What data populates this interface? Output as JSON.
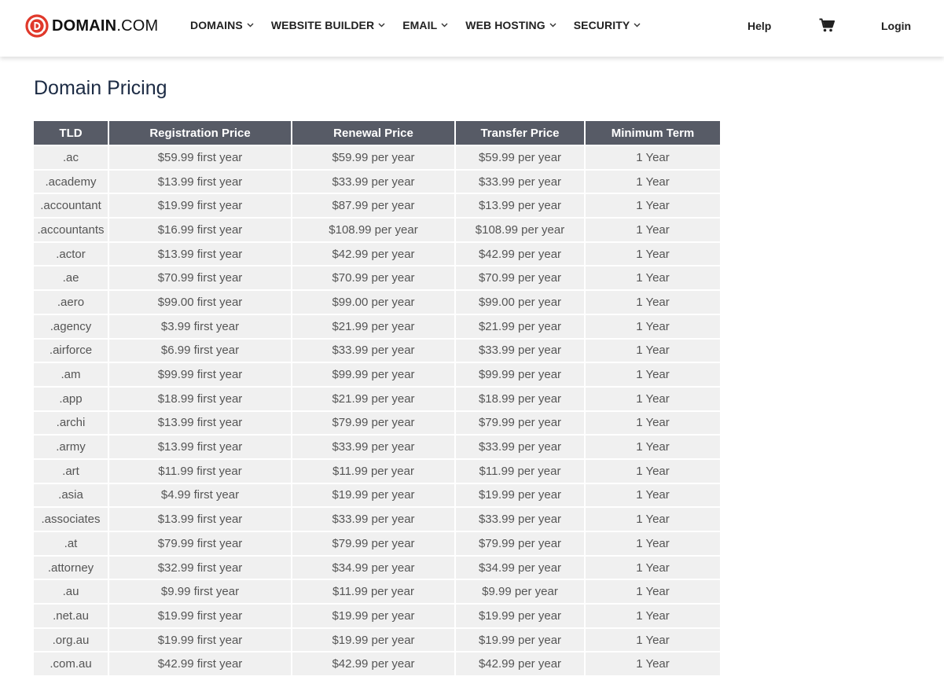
{
  "header": {
    "logo": {
      "brand": "DOMAIN",
      "suffix": ".COM"
    },
    "nav": [
      {
        "label": "DOMAINS",
        "icon": "chevron-down-icon"
      },
      {
        "label": "WEBSITE BUILDER",
        "icon": "chevron-down-icon"
      },
      {
        "label": "EMAIL",
        "icon": "chevron-down-icon"
      },
      {
        "label": "WEB HOSTING",
        "icon": "chevron-down-icon"
      },
      {
        "label": "SECURITY",
        "icon": "chevron-down-icon"
      }
    ],
    "help_label": "Help",
    "cart_icon": "cart-icon",
    "login_label": "Login"
  },
  "colors": {
    "brand_red": "#e0392b",
    "table_header_bg": "#575b66",
    "table_row_bg": "#f0f0f0",
    "title_color": "#1c2b44"
  },
  "page": {
    "title": "Domain Pricing"
  },
  "table": {
    "headers": [
      "TLD",
      "Registration Price",
      "Renewal Price",
      "Transfer Price",
      "Minimum Term"
    ],
    "rows": [
      [
        ".ac",
        "$59.99 first year",
        "$59.99 per year",
        "$59.99 per year",
        "1 Year"
      ],
      [
        ".academy",
        "$13.99 first year",
        "$33.99 per year",
        "$33.99 per year",
        "1 Year"
      ],
      [
        ".accountant",
        "$19.99 first year",
        "$87.99 per year",
        "$13.99 per year",
        "1 Year"
      ],
      [
        ".accountants",
        "$16.99 first year",
        "$108.99 per year",
        "$108.99 per year",
        "1 Year"
      ],
      [
        ".actor",
        "$13.99 first year",
        "$42.99 per year",
        "$42.99 per year",
        "1 Year"
      ],
      [
        ".ae",
        "$70.99 first year",
        "$70.99 per year",
        "$70.99 per year",
        "1 Year"
      ],
      [
        ".aero",
        "$99.00 first year",
        "$99.00 per year",
        "$99.00 per year",
        "1 Year"
      ],
      [
        ".agency",
        "$3.99 first year",
        "$21.99 per year",
        "$21.99 per year",
        "1 Year"
      ],
      [
        ".airforce",
        "$6.99 first year",
        "$33.99 per year",
        "$33.99 per year",
        "1 Year"
      ],
      [
        ".am",
        "$99.99 first year",
        "$99.99 per year",
        "$99.99 per year",
        "1 Year"
      ],
      [
        ".app",
        "$18.99 first year",
        "$21.99 per year",
        "$18.99 per year",
        "1 Year"
      ],
      [
        ".archi",
        "$13.99 first year",
        "$79.99 per year",
        "$79.99 per year",
        "1 Year"
      ],
      [
        ".army",
        "$13.99 first year",
        "$33.99 per year",
        "$33.99 per year",
        "1 Year"
      ],
      [
        ".art",
        "$11.99 first year",
        "$11.99 per year",
        "$11.99 per year",
        "1 Year"
      ],
      [
        ".asia",
        "$4.99 first year",
        "$19.99 per year",
        "$19.99 per year",
        "1 Year"
      ],
      [
        ".associates",
        "$13.99 first year",
        "$33.99 per year",
        "$33.99 per year",
        "1 Year"
      ],
      [
        ".at",
        "$79.99 first year",
        "$79.99 per year",
        "$79.99 per year",
        "1 Year"
      ],
      [
        ".attorney",
        "$32.99 first year",
        "$34.99 per year",
        "$34.99 per year",
        "1 Year"
      ],
      [
        ".au",
        "$9.99 first year",
        "$11.99 per year",
        "$9.99 per year",
        "1 Year"
      ],
      [
        ".net.au",
        "$19.99 first year",
        "$19.99 per year",
        "$19.99 per year",
        "1 Year"
      ],
      [
        ".org.au",
        "$19.99 first year",
        "$19.99 per year",
        "$19.99 per year",
        "1 Year"
      ],
      [
        ".com.au",
        "$42.99 first year",
        "$42.99 per year",
        "$42.99 per year",
        "1 Year"
      ]
    ]
  }
}
